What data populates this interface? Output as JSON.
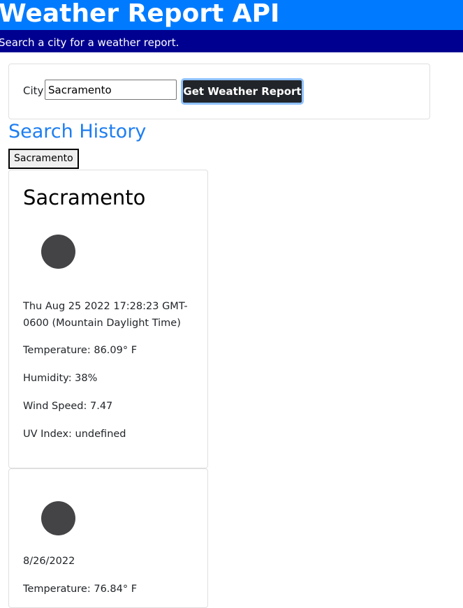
{
  "header": {
    "title": "Weather Report API",
    "subtitle": "Search a city for a weather report."
  },
  "search": {
    "label": "City",
    "value": "Sacramento",
    "button_label": "Get Weather Report"
  },
  "history": {
    "title": "Search History",
    "items": [
      {
        "label": "Sacramento"
      }
    ]
  },
  "current": {
    "city": "Sacramento",
    "icon": "weather-icon",
    "date": "Thu Aug 25 2022 17:28:23 GMT-0600 (Mountain Daylight Time)",
    "temperature": "Temperature: 86.09° F",
    "humidity": "Humidity: 38%",
    "wind": "Wind Speed: 7.47",
    "uv": "UV Index: undefined"
  },
  "forecast": [
    {
      "icon": "weather-icon",
      "date": "8/26/2022",
      "temperature": "Temperature: 76.84° F"
    }
  ]
}
